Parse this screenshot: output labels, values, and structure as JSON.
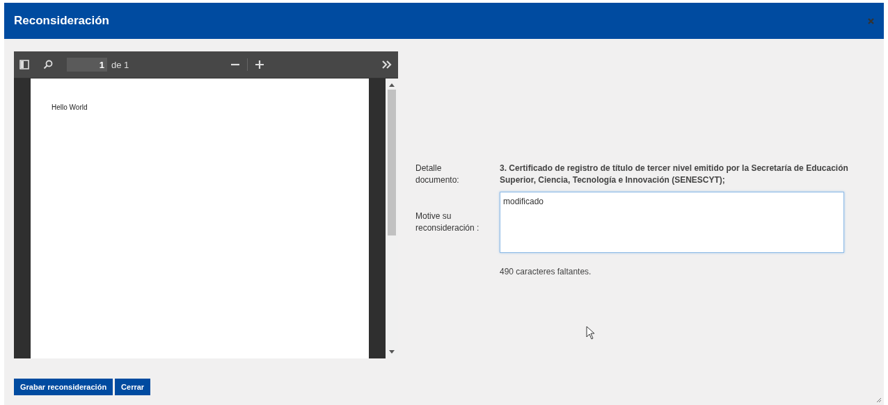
{
  "dialog": {
    "title": "Reconsideración"
  },
  "pdf_viewer": {
    "page_number": "1",
    "page_count": "de 1",
    "document_text": "Hello World"
  },
  "form": {
    "fields": [
      {
        "label": "Detalle documento:",
        "kind": "text",
        "value": "3. Certificado de registro de título de tercer nivel emitido por la Secretaría de Educación Superior, Ciencia, Tecnología e Innovación (SENESCYT);"
      },
      {
        "label": "Motive su reconsideración :",
        "kind": "textarea",
        "value": "modificado"
      }
    ],
    "counter": "490 caracteres faltantes."
  },
  "buttons": [
    "Grabar reconsideración",
    "Cerrar"
  ]
}
